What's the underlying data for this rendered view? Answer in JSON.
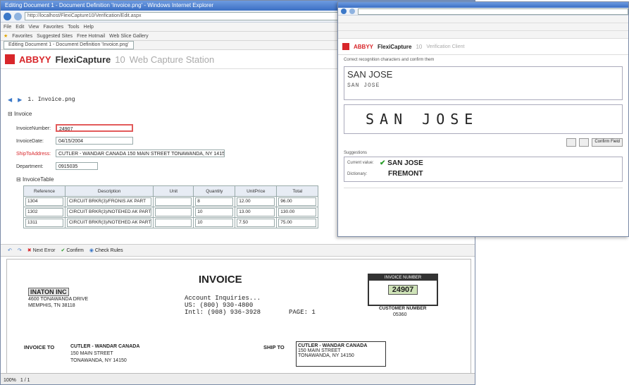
{
  "left": {
    "titlebar": "Editing Document 1 - Document Definition 'Invoice.png' - Windows Internet Explorer",
    "address": "http://localhost/FlexiCapture10/Verification/Edit.aspx",
    "menu": [
      "File",
      "Edit",
      "View",
      "Favorites",
      "Tools",
      "Help"
    ],
    "favorites_bar": [
      "Favorites",
      "Suggested Sites",
      "Free Hotmail",
      "Web Slice Gallery"
    ],
    "tab": "Editing Document 1 - Document Definition 'Invoice.png'",
    "brand": {
      "a": "ABBYY",
      "b": "FlexiCapture",
      "v": "10",
      "c": "Web Capture Station"
    },
    "nav_title": "1. Invoice.png",
    "section": "Invoice",
    "fields": {
      "invoice_number_label": "InvoiceNumber:",
      "invoice_number": "24907",
      "invoice_date_label": "InvoiceDate:",
      "invoice_date": "04/15/2004",
      "ship_address_label": "ShipToAddress:",
      "ship_address": "CUTLER - WANDAR CANADA 150 MAIN STREET TONAWANDA, NY 14150",
      "department_label": "Department:",
      "department": "0915035"
    },
    "table_title": "InvoiceTable",
    "table": {
      "headers": [
        "Reference",
        "Description",
        "Unit",
        "Quantity",
        "UnitPrice",
        "Total"
      ],
      "rows": [
        [
          "1304",
          "CIRCUIT BRKR(3)/FRONIS AK PART",
          "",
          "8",
          "12.00",
          "96.00"
        ],
        [
          "1302",
          "CIRCUIT BRKR(3)/NOTEHED AK PART",
          "",
          "10",
          "13.00",
          "130.00"
        ],
        [
          "1311",
          "CIRCUIT BRKR(3)/NOTEHED AK PART",
          "",
          "10",
          "7.50",
          "75.00"
        ]
      ]
    },
    "toolbar": {
      "next_error": "Next Error",
      "confirm": "Confirm",
      "check_rules": "Check Rules"
    },
    "invoice_doc": {
      "title": "INVOICE",
      "company": "INATON INC",
      "addr1": "4600 TONAWANDA DRIVE",
      "addr2": "MEMPHIS, TN 38118",
      "account": "Account Inquiries...",
      "us": "US: (800) 930-4800",
      "intl": "Intl: (908) 936-3928",
      "page_label": "PAGE:",
      "page": "1",
      "inv_num_label": "INVOICE NUMBER",
      "inv_num": "24907",
      "cust_num_label": "CUSTOMER NUMBER",
      "cust_num": "05360",
      "invoice_to_label": "INVOICE TO",
      "to1": "CUTLER - WANDAR CANADA",
      "to2": "150 MAIN STREET",
      "to3": "TONAWANDA, NY 14150",
      "ship_to_label": "SHIP TO",
      "sh1": "CUTLER - WANDAR CANADA",
      "sh2": "150 MAIN STREET",
      "sh3": "TONAWANDA, NY 14150"
    },
    "status": {
      "zoom": "100%",
      "page": "1 / 1"
    }
  },
  "right": {
    "brand": {
      "a": "ABBYY",
      "b": "FlexiCapture",
      "v": "10",
      "c": "Verification Client"
    },
    "instruction": "Correct recognition characters and confirm them",
    "field_value": "SAN JOSE",
    "field_value_small": "SAN JOSE",
    "handwriting": "SAN JOSE",
    "confirm_all": "Confirm Field",
    "suggest_label": "Suggestions",
    "suggestions": [
      {
        "label": "Current value:",
        "value": "SAN JOSE"
      },
      {
        "label": "Dictionary:",
        "value": "FREMONT"
      }
    ]
  },
  "colors": {
    "accent": "#d8262a",
    "highlight": "#e25b5b",
    "link": "#3b78c8"
  }
}
